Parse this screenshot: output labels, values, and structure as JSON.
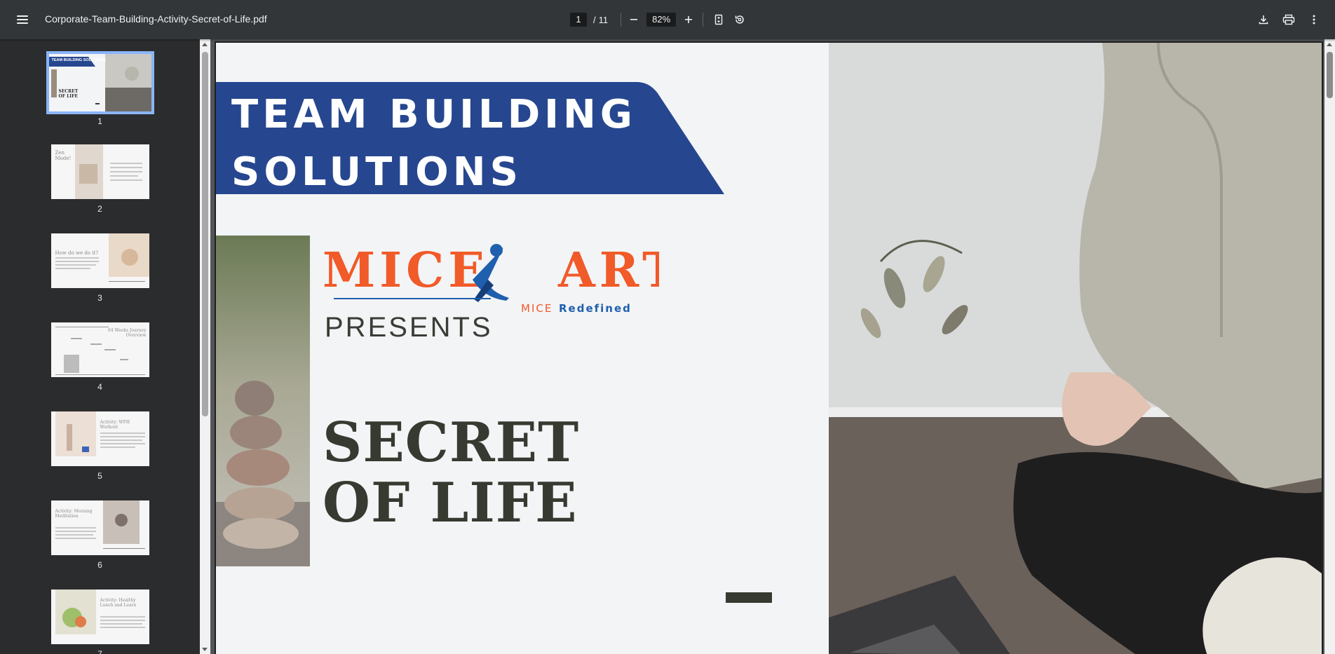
{
  "toolbar": {
    "file_name": "Corporate-Team-Building-Activity-Secret-of-Life.pdf",
    "current_page": "1",
    "page_separator": "/",
    "total_pages": "11",
    "zoom": "82%"
  },
  "sidebar": {
    "thumbnails": [
      {
        "number": "1",
        "active": true
      },
      {
        "number": "2",
        "active": false
      },
      {
        "number": "3",
        "active": false
      },
      {
        "number": "4",
        "active": false
      },
      {
        "number": "5",
        "active": false
      },
      {
        "number": "6",
        "active": false
      },
      {
        "number": "7",
        "active": false
      }
    ],
    "thumb_texts": {
      "t1_banner": "TEAM BUILDING SOLUTIONS",
      "t1_secret": "SECRET OF LIFE",
      "t2_title": "Zen Mode!",
      "t3_title": "How do we do it?",
      "t4_title": "04 Weeks Journey Overview",
      "t5_title": "Activity: WFH Workout",
      "t6_title": "Activity: Morning Meditation",
      "t7_title": "Activity: Healthy Lunch and Learn"
    }
  },
  "page": {
    "banner_line1": "TEAM BUILDING",
    "banner_line2": "SOLUTIONS",
    "logo_left": "MICE",
    "logo_right": "ART",
    "logo_tag_a": "MICE",
    "logo_tag_b": "Redefined",
    "presents": "PRESENTS",
    "title_line1": "SECRET",
    "title_line2": "OF LIFE"
  },
  "colors": {
    "banner_blue": "#26478f",
    "logo_orange": "#f15a29",
    "logo_blue": "#1f5fae",
    "title_dark": "#363a30"
  }
}
